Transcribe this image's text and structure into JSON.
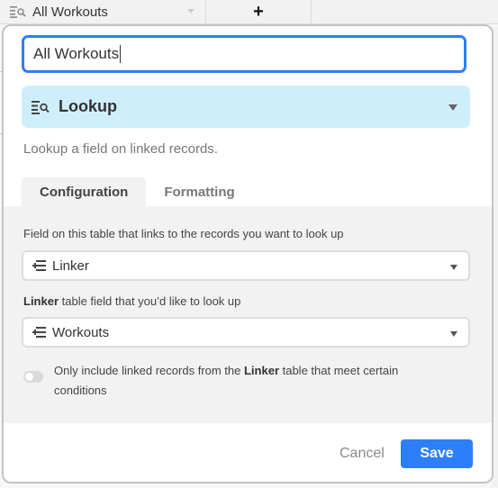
{
  "grid_header": {
    "field_name": "All Workouts",
    "field_icon": "lookup-icon",
    "add_field_label": "+"
  },
  "dialog": {
    "field_name_value": "All Workouts",
    "field_type": {
      "label": "Lookup",
      "icon": "lookup-icon"
    },
    "description": "Lookup a field on linked records.",
    "tabs": [
      {
        "label": "Configuration",
        "active": true
      },
      {
        "label": "Formatting",
        "active": false
      }
    ],
    "config": {
      "link_field_label": "Field on this table that links to the records you want to look up",
      "link_field_value": "Linker",
      "lookup_field_label_bold": "Linker",
      "lookup_field_label_rest": " table field that you’d like to look up",
      "lookup_field_value": "Workouts",
      "condition_toggle": {
        "on": false,
        "text_before": "Only include linked records from the ",
        "text_bold": "Linker",
        "text_after": " table that meet certain conditions"
      }
    },
    "footer": {
      "cancel_label": "Cancel",
      "save_label": "Save"
    }
  },
  "colors": {
    "accent": "#2d7ff9",
    "type_select_bg": "#cfeefc",
    "panel_bg": "#f2f2f2"
  }
}
